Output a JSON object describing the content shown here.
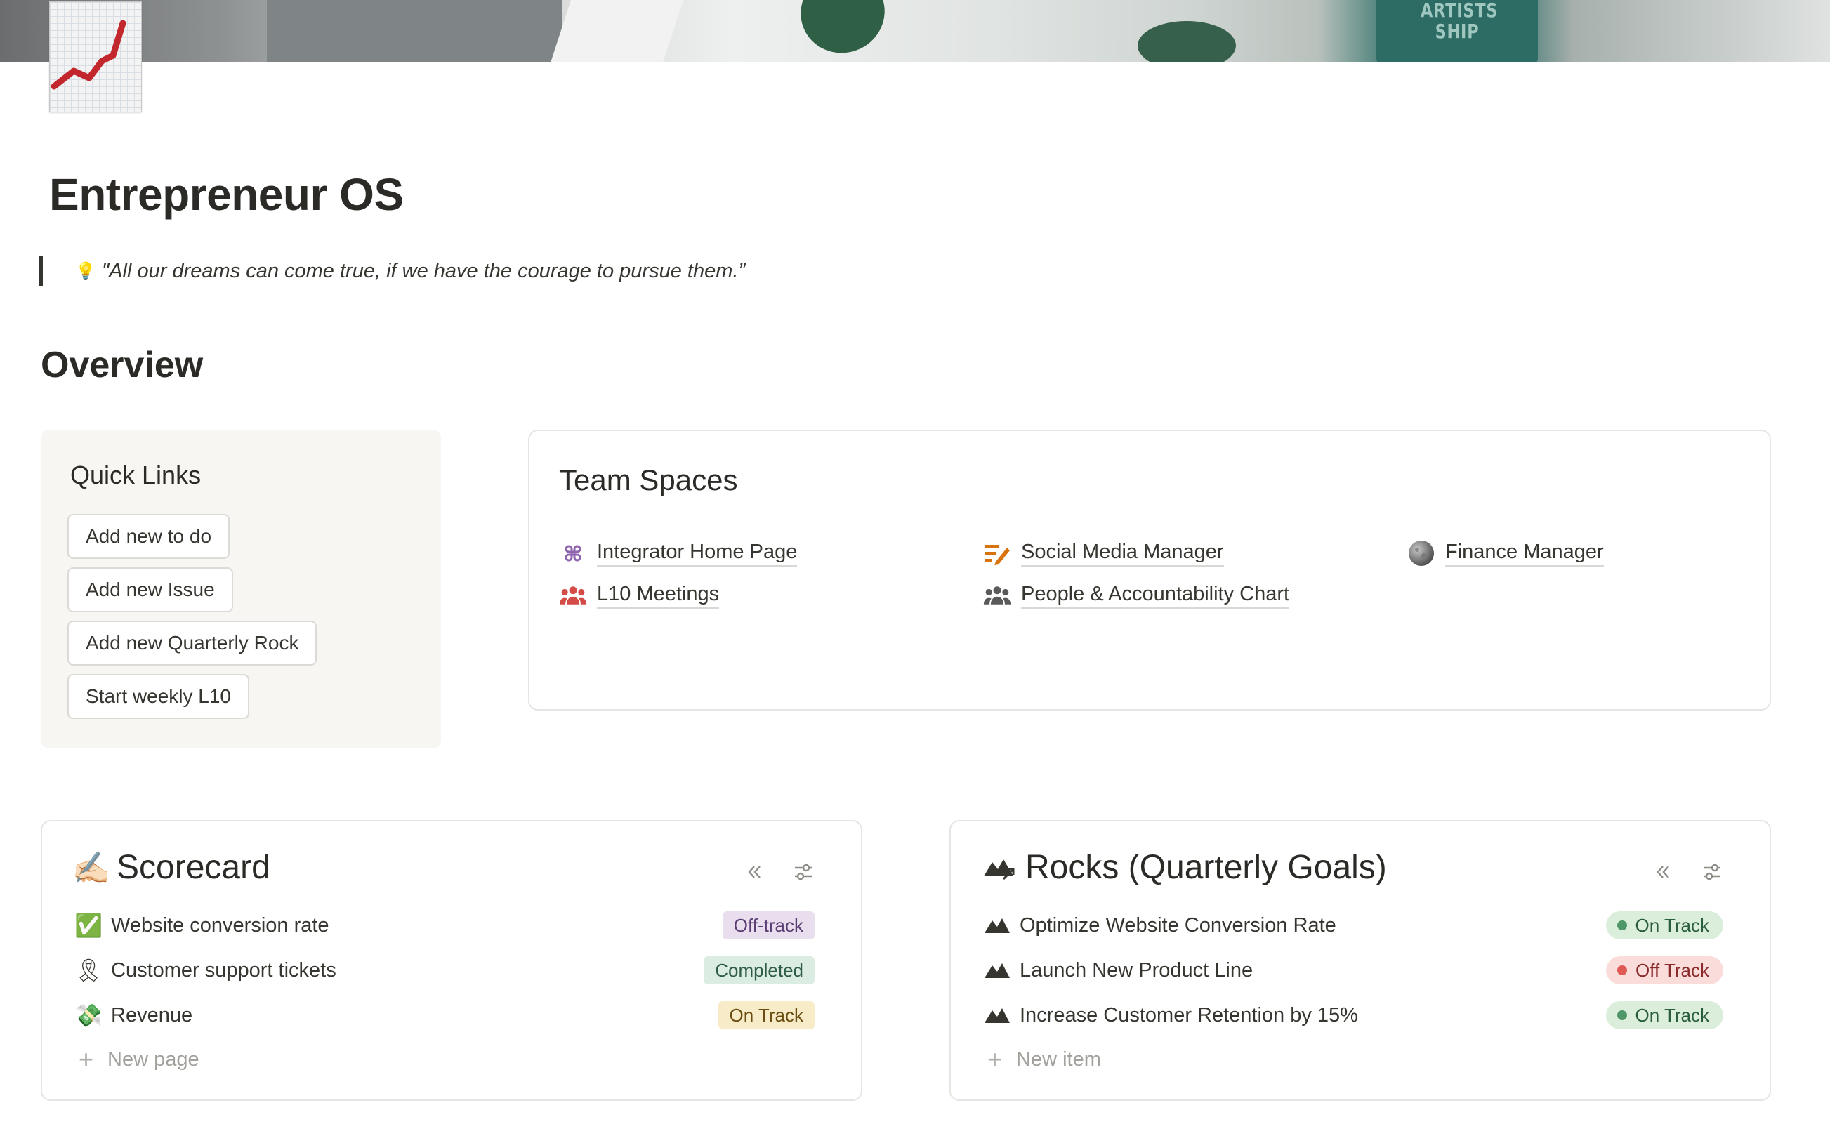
{
  "cover": {
    "text_line1": "ARTISTS",
    "text_line2": "SHIP"
  },
  "page": {
    "title": "Entrepreneur OS",
    "quote": "\"All our dreams can come true, if we have the courage to pursue them.”",
    "section_heading": "Overview"
  },
  "quick_links": {
    "title": "Quick Links",
    "buttons": [
      "Add new to do",
      "Add new Issue",
      "Add new Quarterly Rock",
      "Start weekly L10"
    ]
  },
  "team_spaces": {
    "title": "Team Spaces",
    "links": [
      {
        "label": "Integrator Home Page",
        "icon": "command-icon",
        "color": "#9065b0"
      },
      {
        "label": "Social Media Manager",
        "icon": "edit-list-icon",
        "color": "#d9730d"
      },
      {
        "label": "Finance Manager",
        "icon": "moon-icon",
        "color": "#6f6f6f"
      },
      {
        "label": "L10 Meetings",
        "icon": "group-icon",
        "color": "#d44c47"
      },
      {
        "label": "People & Accountability Chart",
        "icon": "group-icon",
        "color": "#5a5a5a"
      }
    ]
  },
  "scorecard": {
    "title": "Scorecard",
    "rows": [
      {
        "icon": "✅",
        "label": "Website conversion rate",
        "status": "Off-track"
      },
      {
        "icon": "🎗",
        "label": "Customer support tickets",
        "status": "Completed"
      },
      {
        "icon": "💸",
        "label": "Revenue",
        "status": "On Track"
      }
    ],
    "new_label": "New page"
  },
  "rocks": {
    "title": "Rocks (Quarterly Goals)",
    "rows": [
      {
        "label": "Optimize Website Conversion Rate",
        "status": "On Track"
      },
      {
        "label": "Launch New Product Line",
        "status": "Off Track"
      },
      {
        "label": "Increase Customer Retention by 15%",
        "status": "On Track"
      }
    ],
    "new_label": "New item"
  },
  "colors": {
    "status_green_bg": "#dbeddb",
    "status_red_bg": "#fadcdb",
    "status_purple_bg": "#e8deee",
    "status_yellow_bg": "#f8ecc8"
  }
}
